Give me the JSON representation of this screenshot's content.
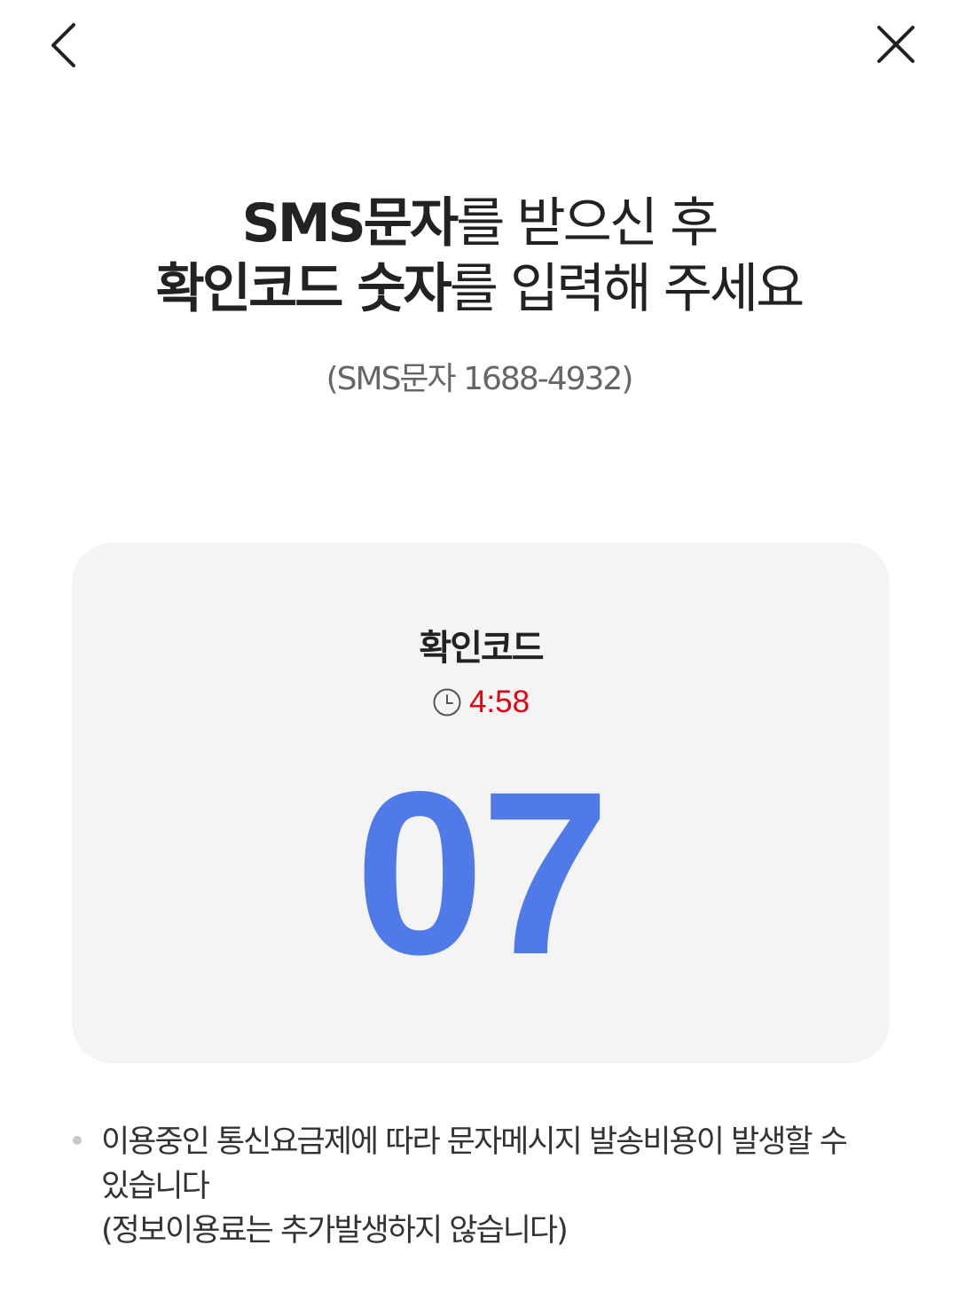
{
  "header": {
    "back_icon": "chevron-left-icon",
    "close_icon": "close-icon"
  },
  "title": {
    "line1_bold": "SMS문자",
    "line1_rest": "를 받으신 후",
    "line2_bold": "확인코드 숫자",
    "line2_rest": "를 입력해 주세요"
  },
  "subtitle": "(SMS문자 1688-4932)",
  "code_card": {
    "label": "확인코드",
    "timer_icon": "clock-icon",
    "timer": "4:58",
    "code": "07",
    "colors": {
      "timer": "#e60012",
      "code": "#4f7ae7",
      "background": "#f4f4f4"
    }
  },
  "notice": {
    "line1": "이용중인 통신요금제에 따라 문자메시지 발송비용이 발생할 수",
    "line2": "있습니다",
    "line3": "(정보이용료는 추가발생하지 않습니다)"
  }
}
